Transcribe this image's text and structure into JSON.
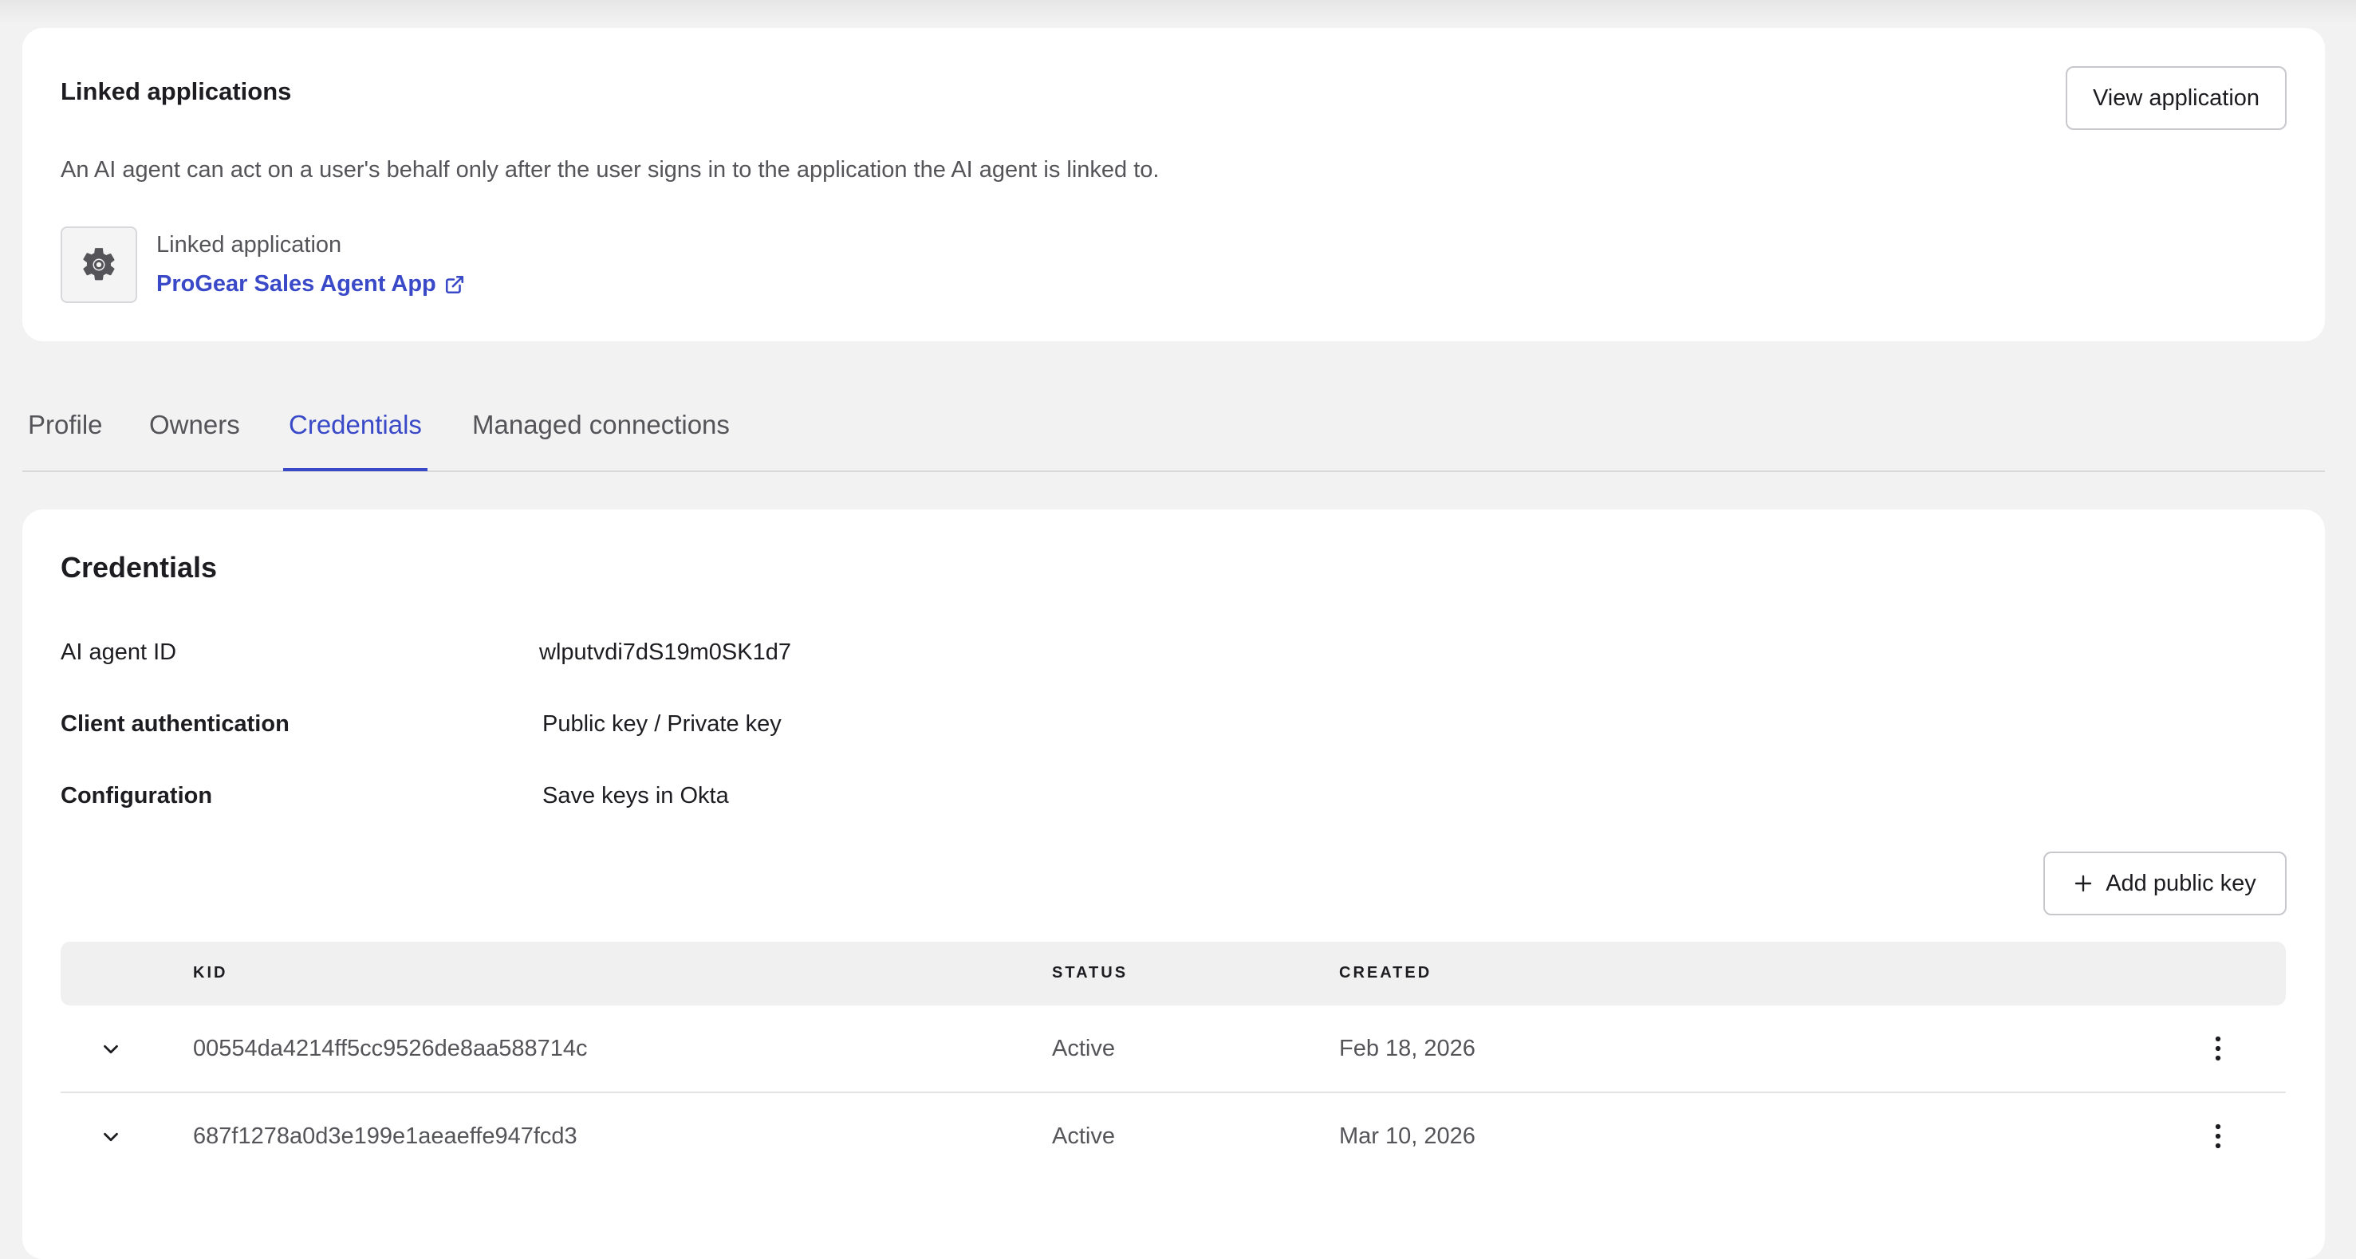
{
  "linked_apps": {
    "title": "Linked applications",
    "view_button": "View application",
    "description": "An AI agent can act on a user's behalf only after the user signs in to the application the AI agent is linked to.",
    "app_label": "Linked application",
    "app_name": "ProGear Sales Agent App",
    "app_icon": "gear-icon",
    "link_icon": "external-link-icon"
  },
  "tabs": [
    {
      "label": "Profile",
      "active": false
    },
    {
      "label": "Owners",
      "active": false
    },
    {
      "label": "Credentials",
      "active": true
    },
    {
      "label": "Managed connections",
      "active": false
    }
  ],
  "credentials": {
    "title": "Credentials",
    "fields": [
      {
        "label": "AI agent ID",
        "value": "wlputvdi7dS19m0SK1d7"
      },
      {
        "label": "Client authentication",
        "value": "Public key / Private key"
      },
      {
        "label": "Configuration",
        "value": "Save keys in Okta"
      }
    ],
    "add_button": "Add public key",
    "table": {
      "columns": [
        "KID",
        "STATUS",
        "CREATED"
      ],
      "rows": [
        {
          "kid": "00554da4214ff5cc9526de8aa588714c",
          "status": "Active",
          "created": "Feb 18, 2026"
        },
        {
          "kid": "687f1278a0d3e199e1aeaeffe947fcd3",
          "status": "Active",
          "created": "Mar 10, 2026"
        }
      ]
    }
  },
  "colors": {
    "accent": "#3949c8",
    "background": "#f2f2f2",
    "card": "#ffffff"
  }
}
